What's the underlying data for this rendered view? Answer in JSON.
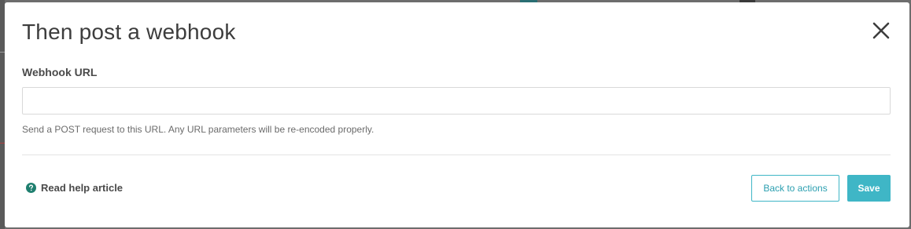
{
  "modal": {
    "title": "Then post a webhook",
    "close_icon": "close-icon"
  },
  "webhook_field": {
    "label": "Webhook URL",
    "value": "",
    "placeholder": "",
    "help_text": "Send a POST request to this URL. Any URL parameters will be re-encoded properly."
  },
  "footer": {
    "help_link_label": "Read help article",
    "help_icon": "question-circle-icon",
    "back_label": "Back to actions",
    "save_label": "Save"
  },
  "colors": {
    "accent": "#3fb6c6",
    "help_icon": "#1f7f6f",
    "title_text": "#3d3d3d",
    "overlay": "#6d6d6d"
  }
}
